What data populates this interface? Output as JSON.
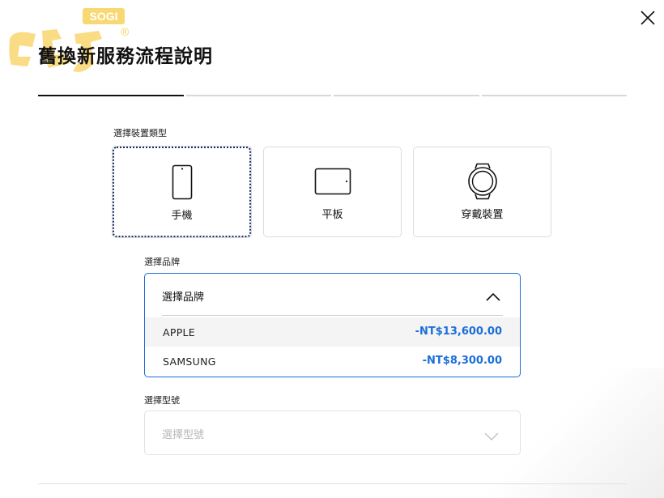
{
  "logo": {
    "badge": "SOGI",
    "registered": "®"
  },
  "header": {
    "title": "舊換新服務流程說明"
  },
  "steps": [
    {
      "active": true
    },
    {
      "active": false
    },
    {
      "active": false
    },
    {
      "active": false
    }
  ],
  "device_type": {
    "label": "選擇裝置類型",
    "options": [
      {
        "label": "手機",
        "icon": "phone-icon",
        "selected": true
      },
      {
        "label": "平板",
        "icon": "tablet-icon",
        "selected": false
      },
      {
        "label": "穿戴裝置",
        "icon": "watch-icon",
        "selected": false
      }
    ]
  },
  "brand": {
    "label": "選擇品牌",
    "placeholder": "選擇品牌",
    "expanded": true,
    "options": [
      {
        "name": "APPLE",
        "price": "-NT$13,600.00"
      },
      {
        "name": "SAMSUNG",
        "price": "-NT$8,300.00"
      }
    ]
  },
  "model": {
    "label": "選擇型號",
    "placeholder": "選擇型號"
  },
  "colors": {
    "accent": "#1a6ed8",
    "selected_border": "#1a2a55",
    "logo_yellow": "#f5c518"
  }
}
